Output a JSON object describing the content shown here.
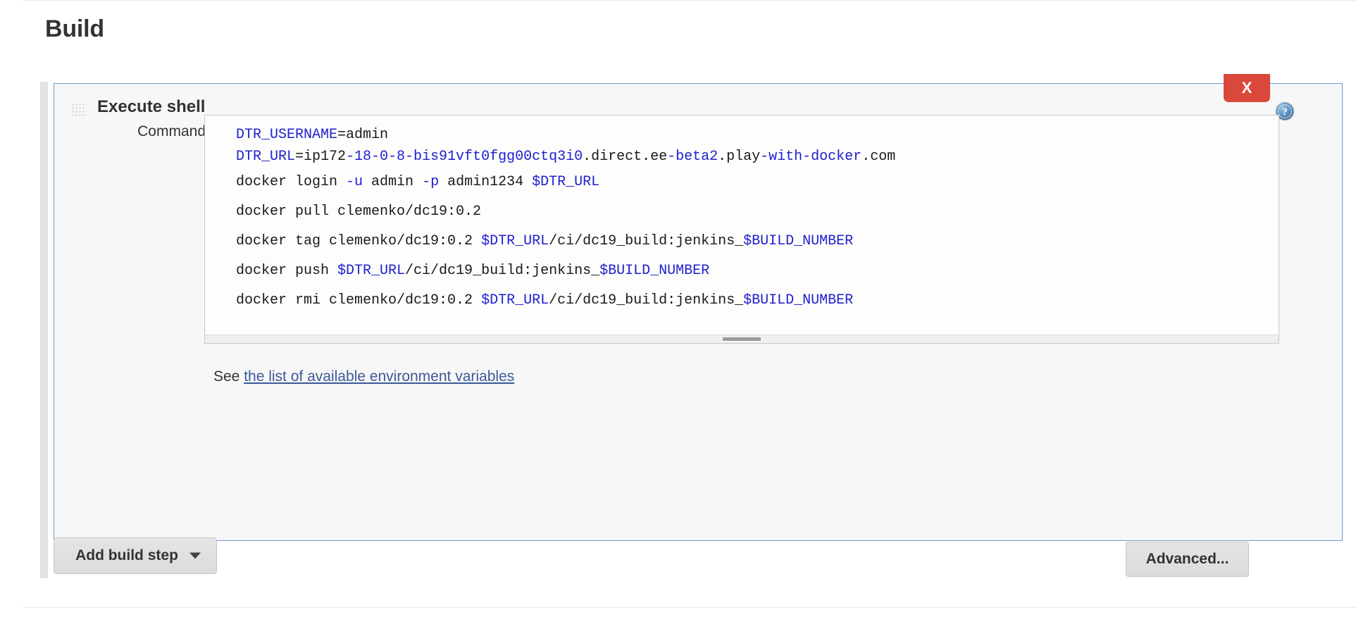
{
  "page": {
    "title": "Build"
  },
  "build_step": {
    "title": "Execute shell",
    "delete_label": "X",
    "help_icon": "help-circle-icon",
    "drag_handle_icon": "drag-grip-icon",
    "command_label": "Command",
    "command_value": "DTR_USERNAME=admin\nDTR_URL=ip172-18-0-8-bis91vft0fgg00ctq3i0.direct.ee-beta2.play-with-docker.com\n\ndocker login -u admin -p admin1234 $DTR_URL\n\ndocker pull clemenko/dc19:0.2\n\ndocker tag clemenko/dc19:0.2 $DTR_URL/ci/dc19_build:jenkins_$BUILD_NUMBER\n\ndocker push $DTR_URL/ci/dc19_build:jenkins_$BUILD_NUMBER\n\ndocker rmi clemenko/dc19:0.2 $DTR_URL/ci/dc19_build:jenkins_$BUILD_NUMBER",
    "command_lines": [
      [
        {
          "t": "DTR_USERNAME",
          "c": "var"
        },
        {
          "t": "=admin",
          "c": "plain"
        }
      ],
      [
        {
          "t": "DTR_URL",
          "c": "var"
        },
        {
          "t": "=ip172",
          "c": "plain"
        },
        {
          "t": "-18-0-8-bis91vft0fgg00ctq3i0",
          "c": "var"
        },
        {
          "t": ".direct.ee",
          "c": "plain"
        },
        {
          "t": "-beta2",
          "c": "var"
        },
        {
          "t": ".play",
          "c": "plain"
        },
        {
          "t": "-with-docker",
          "c": "var"
        },
        {
          "t": ".com",
          "c": "plain"
        }
      ],
      [
        {
          "t": "docker login ",
          "c": "plain"
        },
        {
          "t": "-u",
          "c": "var"
        },
        {
          "t": " admin ",
          "c": "plain"
        },
        {
          "t": "-p",
          "c": "var"
        },
        {
          "t": " admin1234 ",
          "c": "plain"
        },
        {
          "t": "$DTR_URL",
          "c": "var"
        }
      ],
      [
        {
          "t": "docker pull clemenko/dc19:0.2",
          "c": "plain"
        }
      ],
      [
        {
          "t": "docker tag clemenko/dc19:0.2 ",
          "c": "plain"
        },
        {
          "t": "$DTR_URL",
          "c": "var"
        },
        {
          "t": "/ci/dc19_build:jenkins_",
          "c": "plain"
        },
        {
          "t": "$BUILD_NUMBER",
          "c": "var"
        }
      ],
      [
        {
          "t": "docker push ",
          "c": "plain"
        },
        {
          "t": "$DTR_URL",
          "c": "var"
        },
        {
          "t": "/ci/dc19_build:jenkins_",
          "c": "plain"
        },
        {
          "t": "$BUILD_NUMBER",
          "c": "var"
        }
      ],
      [
        {
          "t": "docker rmi clemenko/dc19:0.2 ",
          "c": "plain"
        },
        {
          "t": "$DTR_URL",
          "c": "var"
        },
        {
          "t": "/ci/dc19_build:jenkins_",
          "c": "plain"
        },
        {
          "t": "$BUILD_NUMBER",
          "c": "var"
        }
      ]
    ],
    "help_text_prefix": "See ",
    "help_link_text": "the list of available environment variables",
    "advanced_label": "Advanced..."
  },
  "footer": {
    "add_build_step_label": "Add build step"
  },
  "colors": {
    "panel_border": "#6b9bd2",
    "delete_red": "#d9483b",
    "syntax_variable": "#2020d0",
    "link_blue": "#3b5998",
    "help_icon_blue": "#4a7fb5"
  }
}
